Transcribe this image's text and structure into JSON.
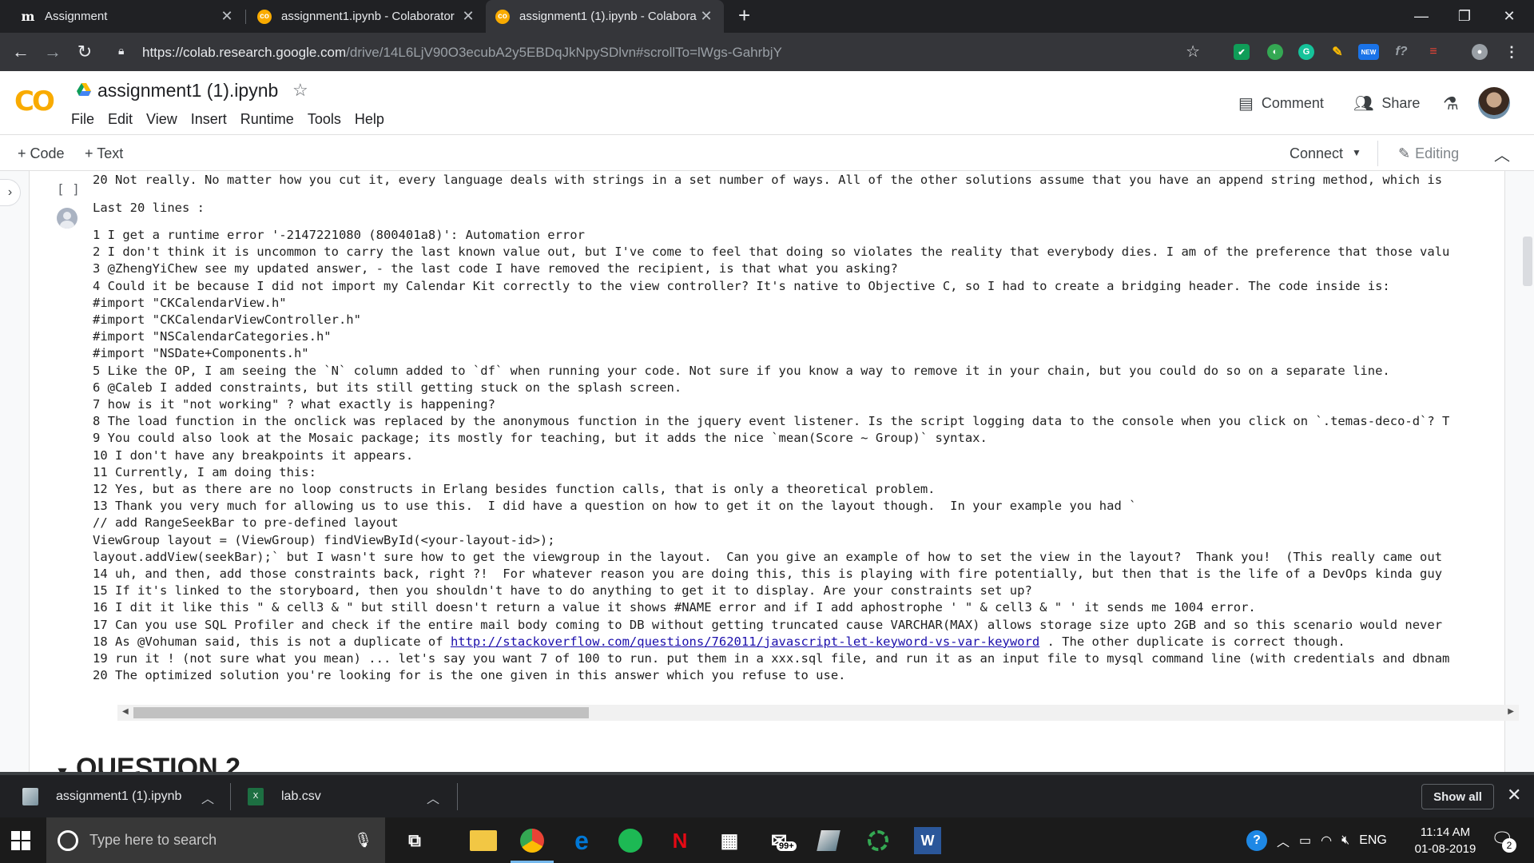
{
  "browser": {
    "tabs": [
      {
        "title": "Assignment",
        "favicon": "m"
      },
      {
        "title": "assignment1.ipynb - Colaborator",
        "favicon": "co"
      },
      {
        "title": "assignment1 (1).ipynb - Colabora",
        "favicon": "co"
      }
    ],
    "url_host": "https://colab.research.google.com",
    "url_path": "/drive/14L6LjV90O3ecubA2y5EBDqJkNpySDlvn#scrollTo=lWgs-GahrbjY",
    "ext_new_badge": "NEW"
  },
  "colab": {
    "logo": "CO",
    "title": "assignment1 (1).ipynb",
    "menu": [
      "File",
      "Edit",
      "View",
      "Insert",
      "Runtime",
      "Tools",
      "Help"
    ],
    "comment_label": "Comment",
    "share_label": "Share",
    "toolbar": {
      "add_code": "+ Code",
      "add_text": "+ Text",
      "connect": "Connect",
      "editing": "Editing"
    },
    "run_bracket": "[ ]",
    "question_heading": "QUESTION 2"
  },
  "output_lines": [
    "20 Not really. No matter how you cut it, every language deals with strings in a set number of ways. All of the other solutions assume that you have an append string method, which is",
    "Last 20 lines :",
    "",
    "1 I get a runtime error '-2147221080 (800401a8)': Automation error",
    "2 I don't think it is uncommon to carry the last known value out, but I've come to feel that doing so violates the reality that everybody dies. I am of the preference that those valu",
    "3 @ZhengYiChew see my updated answer, - the last code I have removed the recipient, is that what you asking?",
    "4 Could it be because I did not import my Calendar Kit correctly to the view controller? It's native to Objective C, so I had to create a bridging header. The code inside is:",
    "#import \"CKCalendarView.h\"",
    "#import \"CKCalendarViewController.h\"",
    "#import \"NSCalendarCategories.h\"",
    "#import \"NSDate+Components.h\"",
    "5 Like the OP, I am seeing the `N` column added to `df` when running your code. Not sure if you know a way to remove it in your chain, but you could do so on a separate line.",
    "6 @Caleb I added constraints, but its still getting stuck on the splash screen.",
    "7 how is it \"not working\" ? what exactly is happening?",
    "8 The load function in the onclick was replaced by the anonymous function in the jquery event listener. Is the script logging data to the console when you click on `.temas-deco-d`? T",
    "9 You could also look at the Mosaic package; its mostly for teaching, but it adds the nice `mean(Score ~ Group)` syntax.",
    "10 I don't have any breakpoints it appears.",
    "11 Currently, I am doing this:",
    "12 Yes, but as there are no loop constructs in Erlang besides function calls, that is only a theoretical problem.",
    "13 Thank you very much for allowing us to use this.  I did have a question on how to get it on the layout though.  In your example you had `",
    "// add RangeSeekBar to pre-defined layout",
    "ViewGroup layout = (ViewGroup) findViewById(<your-layout-id>);",
    "layout.addView(seekBar);` but I wasn't sure how to get the viewgroup in the layout.  Can you give an example of how to set the view in the layout?  Thank you!  (This really came out",
    "14 uh, and then, add those constraints back, right ?!  For whatever reason you are doing this, this is playing with fire potentially, but then that is the life of a DevOps kinda guy",
    "15 If it's linked to the storyboard, then you shouldn't have to do anything to get it to display. Are your constraints set up?",
    "16 I dit it like this \" & cell3 & \" but still doesn't return a value it shows #NAME error and if I add aphostrophe ' \" & cell3 & \" ' it sends me 1004 error.",
    "17 Can you use SQL Profiler and check if the entire mail body coming to DB without getting truncated cause VARCHAR(MAX) allows storage size upto 2GB and so this scenario would never"
  ],
  "line18": {
    "before": "18 As @Vohuman said, this is not a duplicate of ",
    "link": "http://stackoverflow.com/questions/762011/javascript-let-keyword-vs-var-keyword",
    "after": " . The other duplicate is correct though."
  },
  "output_tail": [
    "19 run it ! (not sure what you mean) ... let's say you want 7 of 100 to run. put them in a xxx.sql file, and run it as an input file to mysql command line (with credentials and dbnam",
    "20 The optimized solution you're looking for is the one given in this answer which you refuse to use."
  ],
  "downloads": {
    "items": [
      "assignment1 (1).ipynb",
      "lab.csv"
    ],
    "show_all": "Show all"
  },
  "taskbar": {
    "search_placeholder": "Type here to search",
    "mail_badge": "99+",
    "lang": "ENG",
    "time": "11:14 AM",
    "date": "01-08-2019",
    "notifications": "2"
  }
}
